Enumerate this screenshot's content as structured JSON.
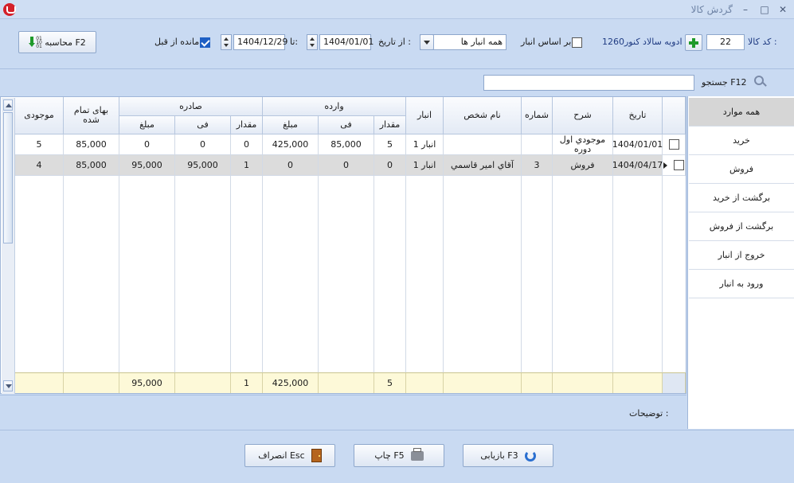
{
  "window": {
    "title": "گردش کالا",
    "minimize": "–",
    "maximize": "□",
    "close": "✕"
  },
  "toolbar": {
    "code_label": "کد کالا :",
    "code_value": "22",
    "product_name": "ادویه سالاد کنور1260",
    "by_warehouse_label": "بر اساس انبار",
    "by_warehouse_checked": false,
    "warehouse_value": "همه انبار ها",
    "from_date_label": "از تاریخ :",
    "from_date": "1404/01/01",
    "to_label": "تا:",
    "to_date": "1404/12/29",
    "prev_balance_label": "مانده از قبل",
    "prev_balance_checked": true,
    "calc_button": "محاسبه F2"
  },
  "search": {
    "label": "جستجو F12",
    "value": ""
  },
  "table": {
    "group_headers": {
      "incoming": "وارده",
      "outgoing": "صادره"
    },
    "headers": {
      "date": "تاریخ",
      "description": "شرح",
      "number": "شماره",
      "person": "نام شخص",
      "warehouse": "انبار",
      "in_qty": "مقدار",
      "in_price": "فی",
      "in_amount": "مبلغ",
      "out_qty": "مقدار",
      "out_price": "فی",
      "out_amount": "مبلغ",
      "cost": "بهای تمام شده",
      "stock": "موجودی"
    },
    "rows": [
      {
        "date": "1404/01/01",
        "description": "موجودي اول دوره",
        "number": "",
        "person": "",
        "warehouse": "انبار 1",
        "in_qty": "5",
        "in_price": "85,000",
        "in_amount": "425,000",
        "out_qty": "0",
        "out_price": "0",
        "out_amount": "0",
        "cost": "85,000",
        "stock": "5"
      },
      {
        "date": "1404/04/17",
        "description": "فروش",
        "number": "3",
        "person": "آقاي امير قاسمي",
        "warehouse": "انبار 1",
        "in_qty": "0",
        "in_price": "0",
        "in_amount": "0",
        "out_qty": "1",
        "out_price": "95,000",
        "out_amount": "95,000",
        "cost": "85,000",
        "stock": "4"
      }
    ],
    "footer": {
      "in_qty": "5",
      "in_amount": "425,000",
      "out_qty": "1",
      "out_amount": "95,000"
    }
  },
  "filters": [
    "همه موارد",
    "خرید",
    "فروش",
    "برگشت از خرید",
    "برگشت از فروش",
    "خروج از انبار",
    "ورود به انبار"
  ],
  "notes": {
    "label": "توضیحات :"
  },
  "buttons": {
    "refresh": "بازیابی F3",
    "print": "چاپ F5",
    "cancel": "انصراف Esc"
  },
  "colors": {
    "background": "#c9daf2",
    "footer": "#fdf9d8",
    "selected_row": "#dcdcdc",
    "accent": "#1e5fc4"
  },
  "icons": [
    "app-icon",
    "add-icon",
    "calculator-icon",
    "search-icon",
    "refresh-icon",
    "printer-icon",
    "exit-door-icon"
  ]
}
